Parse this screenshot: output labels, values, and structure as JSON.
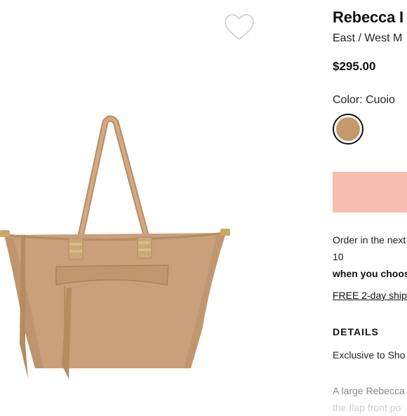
{
  "product": {
    "title": "Rebecca I",
    "subtitle": "East / West M",
    "price": "$295.00",
    "color_label": "Color: Cuoio",
    "swatch_color": "#c49a6c",
    "cta_color": "#f7bdb1",
    "order_line1": "Order in the next",
    "order_line2": "10",
    "order_line3": "when you choos",
    "shipping_link": "FREE 2-day ship",
    "details_heading": "DETAILS",
    "details_text": "Exclusive to Sho",
    "desc_line1": "A large Rebecca",
    "desc_line2": "the flap front po"
  },
  "icons": {
    "favorite": "heart-outline-icon"
  },
  "colors": {
    "bag_leather": "#c9a07a",
    "hardware": "#c8a96a"
  }
}
